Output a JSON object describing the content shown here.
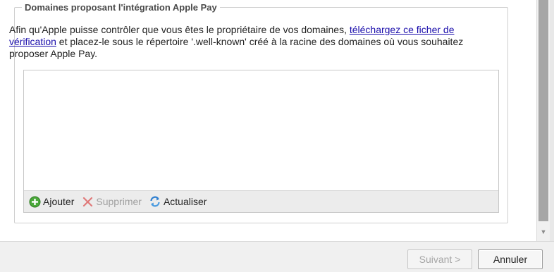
{
  "section": {
    "legend": "Domaines proposant l'intégration Apple Pay",
    "description_before": "Afin qu'Apple puisse contrôler que vous êtes le propriétaire de vos domaines, ",
    "description_link": "téléchargez ce ficher de vérification",
    "description_after": " et placez-le sous le répertoire '.well-known' créé à la racine des domaines où vous souhaitez proposer Apple Pay."
  },
  "list": {
    "items": []
  },
  "toolbar": {
    "add_label": "Ajouter",
    "delete_label": "Supprimer",
    "refresh_label": "Actualiser"
  },
  "footer": {
    "next_label": "Suivant >",
    "cancel_label": "Annuler"
  },
  "icons": {
    "add": "plus-circle-icon",
    "delete": "x-icon",
    "refresh": "refresh-icon"
  },
  "colors": {
    "link": "#1a0dab",
    "add_icon": "#3a9a2a",
    "delete_icon": "#e07a7a",
    "refresh_icon": "#2f7fd0"
  }
}
